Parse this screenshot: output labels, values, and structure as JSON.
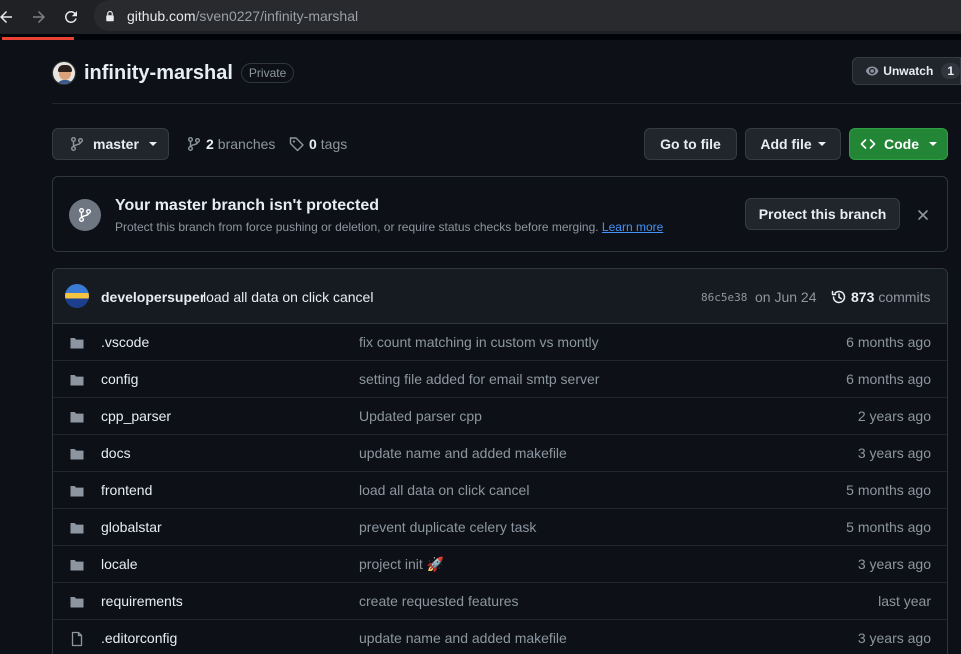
{
  "browser": {
    "url_host": "github.com",
    "url_path": "/sven0227/infinity-marshal"
  },
  "repo": {
    "name": "infinity-marshal",
    "visibility": "Private",
    "watch_label": "Unwatch",
    "watch_count": "1"
  },
  "toolbar": {
    "branch": "master",
    "branches_count": "2",
    "branches_label": "branches",
    "tags_count": "0",
    "tags_label": "tags",
    "goto_file": "Go to file",
    "add_file": "Add file",
    "code": "Code"
  },
  "protect_banner": {
    "title": "Your master branch isn't protected",
    "description": "Protect this branch from force pushing or deletion, or require status checks before merging.",
    "learn_more": "Learn more",
    "button": "Protect this branch"
  },
  "latest_commit": {
    "author": "developersuper",
    "message": "load all data on click cancel",
    "sha": "86c5e38",
    "date": "on Jun 24",
    "commit_count": "873",
    "commits_label": "commits"
  },
  "files": [
    {
      "type": "dir",
      "name": ".vscode",
      "message": "fix count matching in custom vs montly",
      "date": "6 months ago"
    },
    {
      "type": "dir",
      "name": "config",
      "message": "setting file added for email smtp server",
      "date": "6 months ago"
    },
    {
      "type": "dir",
      "name": "cpp_parser",
      "message": "Updated parser cpp",
      "date": "2 years ago"
    },
    {
      "type": "dir",
      "name": "docs",
      "message": "update name and added makefile",
      "date": "3 years ago"
    },
    {
      "type": "dir",
      "name": "frontend",
      "message": "load all data on click cancel",
      "date": "5 months ago"
    },
    {
      "type": "dir",
      "name": "globalstar",
      "message": "prevent duplicate celery task",
      "date": "5 months ago"
    },
    {
      "type": "dir",
      "name": "locale",
      "message": "project init 🚀",
      "date": "3 years ago"
    },
    {
      "type": "dir",
      "name": "requirements",
      "message": "create requested features",
      "date": "last year"
    },
    {
      "type": "file",
      "name": ".editorconfig",
      "message": "update name and added makefile",
      "date": "3 years ago"
    }
  ],
  "colors": {
    "background": "#0d1117",
    "border": "#30363d",
    "muted_text": "#8d96a0",
    "link": "#4493f8",
    "code_button": "#238636",
    "load_progress": "#ea4335"
  }
}
